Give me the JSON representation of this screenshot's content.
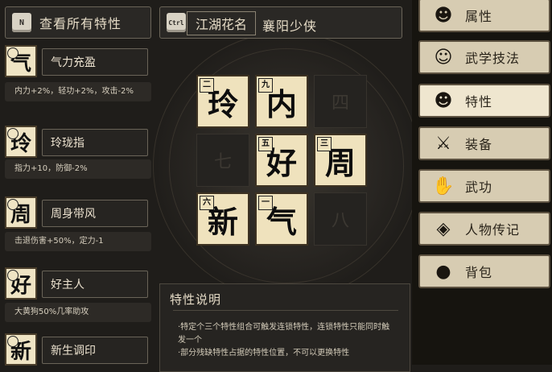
{
  "top_bar": {
    "view_all_key": "N",
    "view_all_label": "查看所有特性",
    "nickname_key": "Ctrl",
    "nickname_title": "江湖花名",
    "nickname_value": "襄阳少侠"
  },
  "traits": [
    {
      "char": "气",
      "name": "气力充盈",
      "desc": "内力+2%，轻功+2%，攻击-2%"
    },
    {
      "char": "玲",
      "name": "玲珑指",
      "desc": "指力+10，防御-2%"
    },
    {
      "char": "周",
      "name": "周身带风",
      "desc": "击退伤害+50%，定力-1"
    },
    {
      "char": "好",
      "name": "好主人",
      "desc": "大黄狗50%几率助攻"
    },
    {
      "char": "新",
      "name": "新生调印",
      "desc": ""
    }
  ],
  "grid": {
    "cells": [
      {
        "row": 0,
        "col": 0,
        "num": "二",
        "char": "玲",
        "filled": true
      },
      {
        "row": 0,
        "col": 1,
        "num": "九",
        "char": "内",
        "filled": true
      },
      {
        "row": 0,
        "col": 2,
        "num": "",
        "char": "四",
        "filled": false
      },
      {
        "row": 1,
        "col": 0,
        "num": "",
        "char": "七",
        "filled": false
      },
      {
        "row": 1,
        "col": 1,
        "num": "五",
        "char": "好",
        "filled": true
      },
      {
        "row": 1,
        "col": 2,
        "num": "三",
        "char": "周",
        "filled": true
      },
      {
        "row": 2,
        "col": 0,
        "num": "六",
        "char": "新",
        "filled": true
      },
      {
        "row": 2,
        "col": 1,
        "num": "一",
        "char": "气",
        "filled": true
      },
      {
        "row": 2,
        "col": 2,
        "num": "",
        "char": "八",
        "filled": false
      }
    ]
  },
  "description_panel": {
    "title": "特性说明",
    "lines": [
      "·特定个三个特性组合可触发连锁特性，连锁特性只能同时触发一个",
      "·部分残缺特性占据的特性位置，不可以更换特性"
    ]
  },
  "menu": [
    {
      "label": "属性",
      "icon": "person-icon",
      "active": false
    },
    {
      "label": "武学技法",
      "icon": "martial-skill-icon",
      "active": false
    },
    {
      "label": "特性",
      "icon": "trait-icon",
      "active": true
    },
    {
      "label": "装备",
      "icon": "sword-icon",
      "active": false
    },
    {
      "label": "武功",
      "icon": "kungfu-book-icon",
      "active": false
    },
    {
      "label": "人物传记",
      "icon": "biography-icon",
      "active": false
    },
    {
      "label": "背包",
      "icon": "bag-icon",
      "active": false
    }
  ]
}
